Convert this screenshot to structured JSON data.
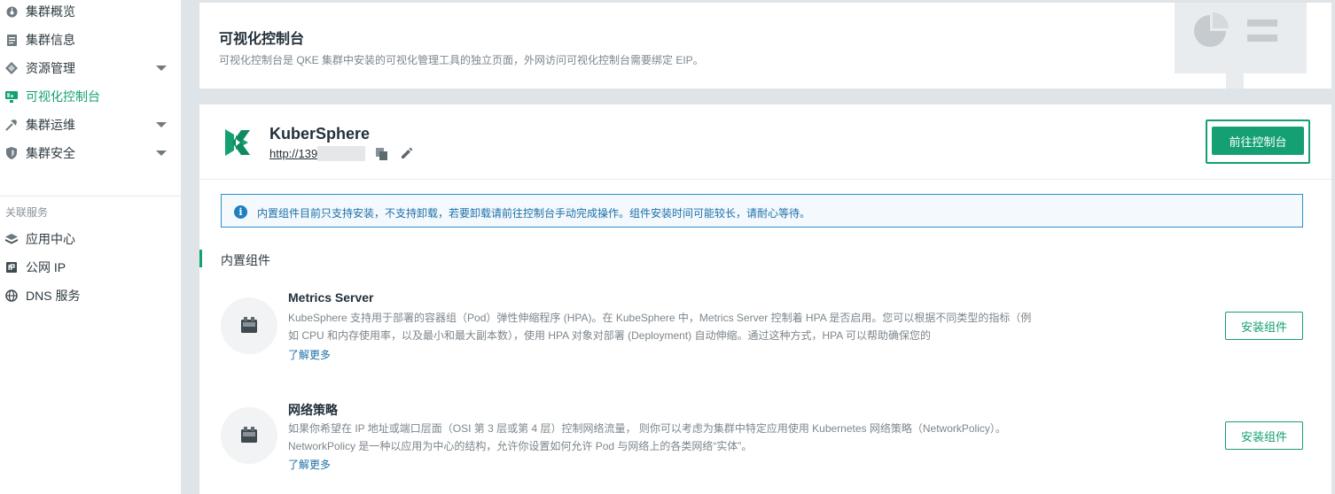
{
  "sidebar": {
    "items": [
      {
        "label": "集群概览",
        "icon": "dashboard-icon"
      },
      {
        "label": "集群信息",
        "icon": "info-doc-icon"
      },
      {
        "label": "资源管理",
        "icon": "resource-icon",
        "expandable": true
      },
      {
        "label": "可视化控制台",
        "icon": "monitor-icon",
        "active": true
      },
      {
        "label": "集群运维",
        "icon": "hammer-icon",
        "expandable": true
      },
      {
        "label": "集群安全",
        "icon": "shield-icon",
        "expandable": true
      }
    ],
    "related_label": "关联服务",
    "related": [
      {
        "label": "应用中心",
        "icon": "layers-icon"
      },
      {
        "label": "公网 IP",
        "icon": "ip-icon"
      },
      {
        "label": "DNS 服务",
        "icon": "globe-icon"
      }
    ]
  },
  "banner": {
    "title": "可视化控制台",
    "description": "可视化控制台是 QKE 集群中安装的可视化管理工具的独立页面，外网访问可视化控制台需要绑定 EIP。"
  },
  "kubesphere": {
    "name": "KuberSphere",
    "url": "http://139",
    "goto_label": "前往控制台"
  },
  "info": {
    "text": "内置组件目前只支持安装，不支持卸载，若要卸载请前往控制台手动完成操作。组件安装时间可能较长，请耐心等待。"
  },
  "builtin": {
    "title": "内置组件",
    "components": [
      {
        "name": "Metrics Server",
        "desc_line1": "KubeSphere 支持用于部署的容器组（Pod）弹性伸缩程序 (HPA)。在 KubeSphere 中，Metrics Server 控制着 HPA 是否启用。您可以根据不同类型的指标（例",
        "desc_line2": "如 CPU 和内存使用率，以及最小和最大副本数），使用 HPA 对象对部署 (Deployment) 自动伸缩。通过这种方式，HPA 可以帮助确保您的",
        "more": "了解更多",
        "install": "安装组件"
      },
      {
        "name": "网络策略",
        "desc_line1": "如果你希望在 IP 地址或端口层面（OSI 第 3 层或第 4 层）控制网络流量， 则你可以考虑为集群中特定应用使用 Kubernetes 网络策略（NetworkPolicy）。",
        "desc_line2": "NetworkPolicy 是一种以应用为中心的结构，允许你设置如何允许 Pod 与网络上的各类网络“实体”。",
        "more": "了解更多",
        "install": "安装组件"
      }
    ]
  },
  "colors": {
    "accent": "#15a074",
    "info": "#1f6fa8"
  }
}
